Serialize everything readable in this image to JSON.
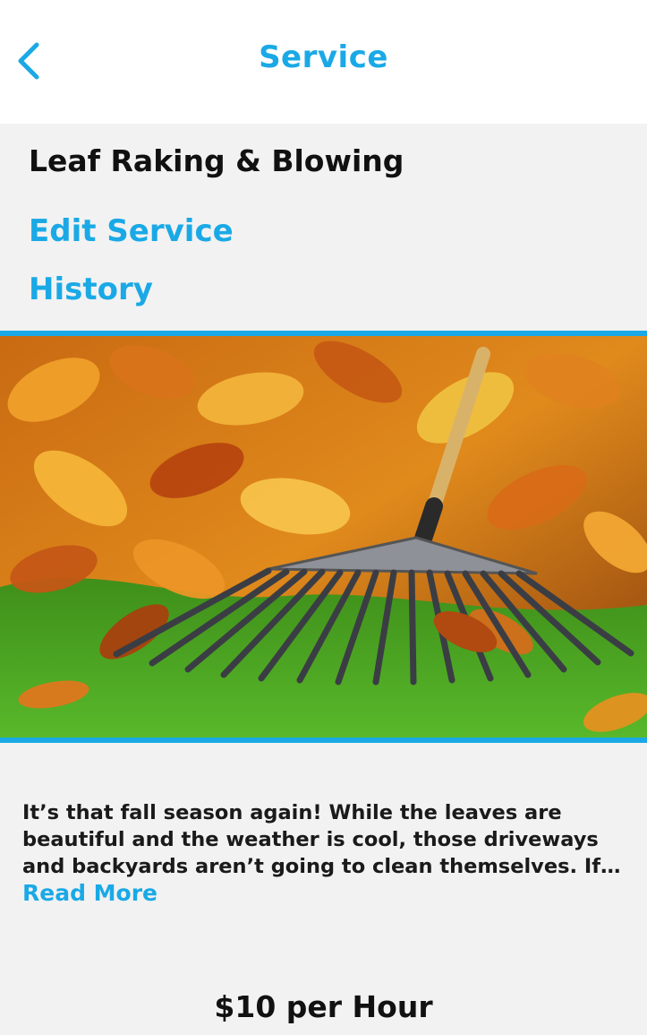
{
  "header": {
    "title": "Service",
    "back_icon": "chevron-left-icon"
  },
  "service": {
    "name": "Leaf Raking & Blowing",
    "edit_label": "Edit Service",
    "history_label": "History",
    "image_subject": "rake-in-autumn-leaves",
    "description": "It’s that fall season again! While the leaves are beautiful and the weather is cool, those driveways and backyards aren’t going to clean themselves. If y…",
    "read_more_label": "Read More",
    "price": "$10 per Hour"
  },
  "colors": {
    "accent": "#1aa9e6",
    "background": "#f2f2f2",
    "header_bg": "#ffffff",
    "text": "#111111"
  }
}
